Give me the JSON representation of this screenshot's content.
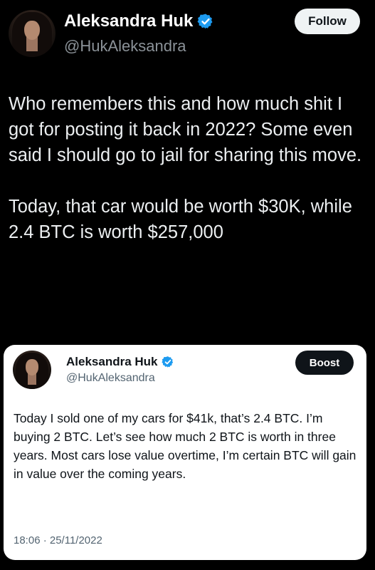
{
  "author": {
    "name": "Aleksandra Huk",
    "handle": "@HukAleksandra",
    "verified_icon": "verified-badge-icon",
    "follow_label": "Follow"
  },
  "tweet": {
    "paragraphs": [
      "Who remembers this and how much shit I got for posting it back in 2022? Some even said I should go to jail for sharing this move.",
      "Today, that car would be worth $30K, while 2.4 BTC is worth $257,000"
    ]
  },
  "quoted": {
    "name": "Aleksandra Huk",
    "handle": "@HukAleksandra",
    "boost_label": "Boost",
    "text": "Today I sold one of my cars for $41k, that’s 2.4 BTC. I’m buying 2 BTC. Let’s see how much 2 BTC is worth in three years. Most cars lose value overtime, I’m certain BTC will gain in value over the coming years.",
    "timestamp": "18:06 · 25/11/2022"
  },
  "colors": {
    "background": "#000000",
    "verified_blue": "#1d9bf0",
    "follow_bg": "#eff3f4",
    "boost_bg": "#0f1419",
    "secondary_text": "#8b9298"
  }
}
